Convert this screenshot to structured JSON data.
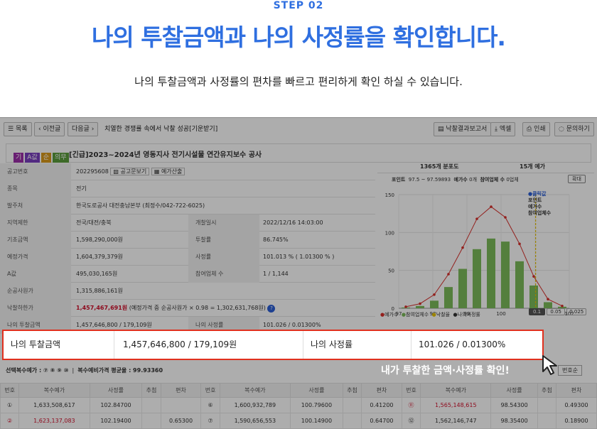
{
  "intro": {
    "step": "STEP 02",
    "title": "나의 투찰금액과 나의 사정률을 확인합니다.",
    "subtitle": "나의 투찰금액과 사정률의 편차를 빠르고 편리하게 확인 하실 수 있습니다."
  },
  "toolbar": {
    "list": "목록",
    "prev": "이전글",
    "next": "다음글",
    "notice": "치열한 경쟁률 속에서 낙찰 성공[기운받기]",
    "report": "낙찰결과보고서",
    "excel": "엑셀",
    "print": "인쇄",
    "inquiry": "문의하기"
  },
  "header": {
    "chips": [
      "기",
      "A값",
      "순",
      "의무"
    ],
    "title": "[긴급]2023~2024년 영동지사 전기시설물 연간유지보수 공사"
  },
  "info": {
    "rows": [
      {
        "label": "공고번호",
        "value": "202295608",
        "extra1": "공고문보기",
        "extra2": "예가산출"
      },
      {
        "label": "종목",
        "value": "전기"
      },
      {
        "label": "발주처",
        "value": "한국도로공사 대전충남본부 (최정수/042-722-6025)"
      },
      {
        "label": "지역제한",
        "value": "전국/대전/충북",
        "label2": "개찰일시",
        "value2": "2022/12/16 14:03:00"
      },
      {
        "label": "기초금액",
        "value": "1,598,290,000원",
        "label2": "투찰률",
        "value2": "86.745%"
      },
      {
        "label": "예정가격",
        "value": "1,604,379,379원",
        "label2": "사정률",
        "value2": "101.013 % ( 1.01300 % )"
      },
      {
        "label": "A값",
        "value": "495,030,165원",
        "label2": "참여업체 수",
        "value2": "1 / 1,144"
      },
      {
        "label": "순공사원가",
        "value": "1,315,886,161원"
      },
      {
        "label": "낙찰하한가",
        "value": "1,457,467,691원",
        "note": "(예정가격 중 순공사원가 × 0.98 = 1,302,631,768원)"
      },
      {
        "label": "나의 투찰금액",
        "value": "1,457,646,800 / 179,109원",
        "label2": "나의 사정률",
        "value2": "101.026 / 0.01300%"
      }
    ]
  },
  "chart": {
    "dist_label": "1365개 분포도",
    "price_label": "15개 예가",
    "point_label": "포인트",
    "point_range": "97.5 ~ 97.59893",
    "price_count_label": "예가수",
    "price_count": "0개",
    "bidders_label": "참여업체 수",
    "bidders": "0업체",
    "zoom": "확대",
    "legend_tip": [
      "●클릭값",
      "포인트",
      "예가수",
      "참여업체수"
    ],
    "legend": [
      "예가수",
      "참여업체수",
      "낙찰율",
      "나의사정률"
    ],
    "scales": [
      "0.1",
      "0.05",
      "0.025"
    ],
    "colors": {
      "red": "#d9302c",
      "green": "#7cbc5a",
      "yellow": "#e5c100",
      "blue": "#2c5fd6"
    }
  },
  "chart_data": {
    "type": "bar",
    "x": [
      97,
      98,
      99,
      100,
      101,
      102
    ],
    "ylim": [
      0,
      150
    ],
    "yticks": [
      0,
      50,
      100,
      150
    ],
    "series": [
      {
        "name": "예가수",
        "values": [
          2,
          6,
          18,
          45,
          80,
          118,
          134,
          120,
          85,
          42,
          12,
          3
        ]
      },
      {
        "name": "참여업체수",
        "values": [
          1,
          3,
          10,
          28,
          52,
          78,
          92,
          88,
          62,
          30,
          8,
          2
        ]
      }
    ]
  },
  "highlight": {
    "label1": "나의 투찰금액",
    "value1": "1,457,646,800 / 179,109원",
    "label2": "나의 사정률",
    "value2": "101.026 / 0.01300%"
  },
  "callout": "내가 투찰한 금액·사정률 확인!",
  "bottom": {
    "selected": "선택복수예가 : ⑦ ⑧ ⑨ ⑩",
    "avg": "복수예비가격 평균율 : 99.93360",
    "sort": "번호순"
  },
  "table": {
    "headers": [
      "번호",
      "복수예가",
      "사정률",
      "추첨",
      "편차",
      "번호",
      "복수예가",
      "사정률",
      "추첨",
      "편차",
      "번호",
      "복수예가",
      "사정률",
      "추첨",
      "편차"
    ],
    "rows": [
      [
        "①",
        "1,633,508,617",
        "102.84700",
        "",
        "",
        "⑥",
        "1,600,932,789",
        "100.79600",
        "",
        "0.41200",
        "⑪",
        "1,565,148,615",
        "98.54300",
        "",
        "0.49300"
      ],
      [
        "②",
        "1,623,137,083",
        "102.19400",
        "",
        "0.65300",
        "⑦",
        "1,590,656,553",
        "100.14900",
        "",
        "0.64700",
        "⑫",
        "1,562,146,747",
        "98.35400",
        "",
        "0.18900"
      ]
    ]
  }
}
